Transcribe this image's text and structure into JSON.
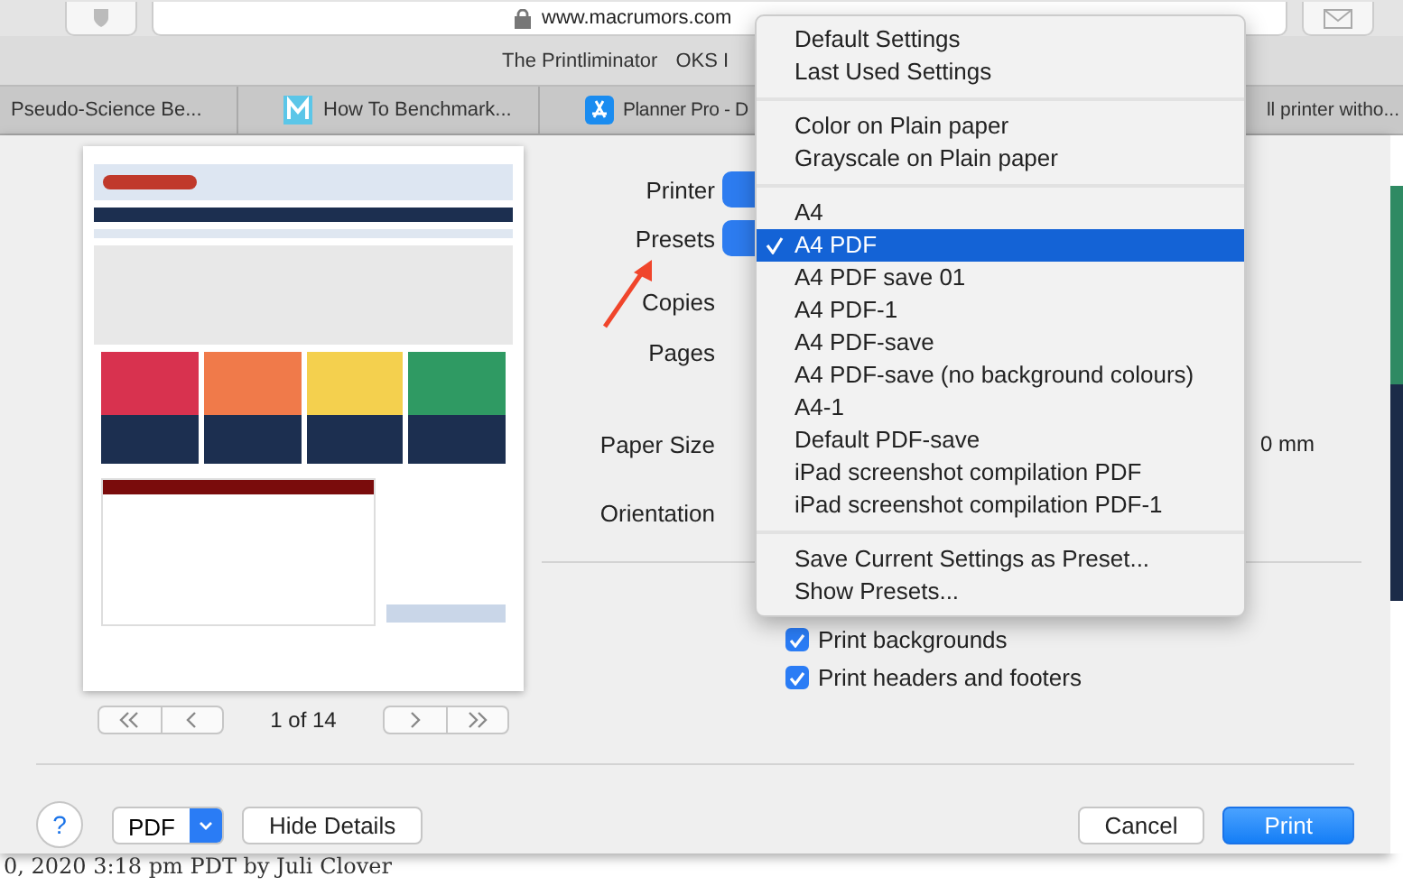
{
  "browser": {
    "address": "www.macrumors.com",
    "bookmarks": [
      "The Printliminator",
      "OKS I"
    ],
    "tabs": [
      {
        "title": "Pseudo-Science Be...",
        "kind": "plain"
      },
      {
        "title": "How To Benchmark...",
        "kind": "m-logo"
      },
      {
        "title": "Planner Pro - D",
        "kind": "app-store"
      },
      {
        "title": "ll printer witho...",
        "kind": "plain"
      }
    ]
  },
  "dialog": {
    "page_indicator": "1 of 14",
    "fields": [
      {
        "label": "Printer",
        "kind": "popup"
      },
      {
        "label": "Presets",
        "kind": "popup"
      },
      {
        "label": "Copies",
        "kind": "plain"
      },
      {
        "label": "Pages",
        "kind": "plain"
      },
      {
        "label": "Paper Size",
        "kind": "value",
        "value": "0 mm"
      },
      {
        "label": "Orientation",
        "kind": "plain"
      }
    ],
    "options": [
      {
        "label": "Print backgrounds",
        "checked": true
      },
      {
        "label": "Print headers and footers",
        "checked": true
      }
    ],
    "help": "?",
    "pdf": "PDF",
    "hide_details": "Hide Details",
    "cancel": "Cancel",
    "print": "Print"
  },
  "menu": {
    "groups": [
      [
        {
          "label": "Default Settings",
          "selected": false
        },
        {
          "label": "Last Used Settings",
          "selected": false
        }
      ],
      [
        {
          "label": "Color on Plain paper",
          "selected": false
        },
        {
          "label": "Grayscale on Plain paper",
          "selected": false
        }
      ],
      [
        {
          "label": "A4",
          "selected": false
        },
        {
          "label": "A4 PDF",
          "selected": true
        },
        {
          "label": "A4 PDF save 01",
          "selected": false
        },
        {
          "label": "A4 PDF-1",
          "selected": false
        },
        {
          "label": "A4 PDF-save",
          "selected": false
        },
        {
          "label": "A4 PDF-save (no background colours)",
          "selected": false
        },
        {
          "label": "A4-1",
          "selected": false
        },
        {
          "label": "Default PDF-save",
          "selected": false
        },
        {
          "label": "iPad screenshot compilation PDF",
          "selected": false
        },
        {
          "label": "iPad screenshot compilation PDF-1",
          "selected": false
        }
      ],
      [
        {
          "label": "Save Current Settings as Preset...",
          "selected": false
        },
        {
          "label": "Show Presets...",
          "selected": false
        }
      ]
    ]
  },
  "page_text": "0, 2020 3:18 pm PDT by Juli Clover"
}
